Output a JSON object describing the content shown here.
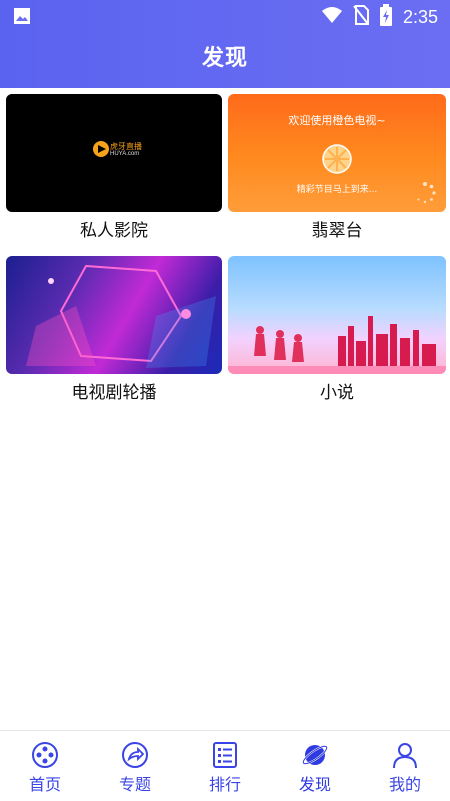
{
  "status": {
    "time": "2:35"
  },
  "header": {
    "title": "发现"
  },
  "cards": [
    {
      "label": "私人影院",
      "thumb_text_main": "虎牙直播",
      "thumb_text_sub": "HUYA.com"
    },
    {
      "label": "翡翠台",
      "thumb_text_main": "欢迎使用橙色电视~",
      "thumb_text_sub": "精彩节目马上到来..."
    },
    {
      "label": "电视剧轮播"
    },
    {
      "label": "小说"
    }
  ],
  "nav": [
    {
      "label": "首页",
      "icon": "film-reel-icon"
    },
    {
      "label": "专题",
      "icon": "share-arrow-icon"
    },
    {
      "label": "排行",
      "icon": "list-icon"
    },
    {
      "label": "发现",
      "icon": "planet-icon"
    },
    {
      "label": "我的",
      "icon": "user-icon"
    }
  ],
  "colors": {
    "accent": "#5a63f0",
    "nav": "#3b45e6"
  }
}
